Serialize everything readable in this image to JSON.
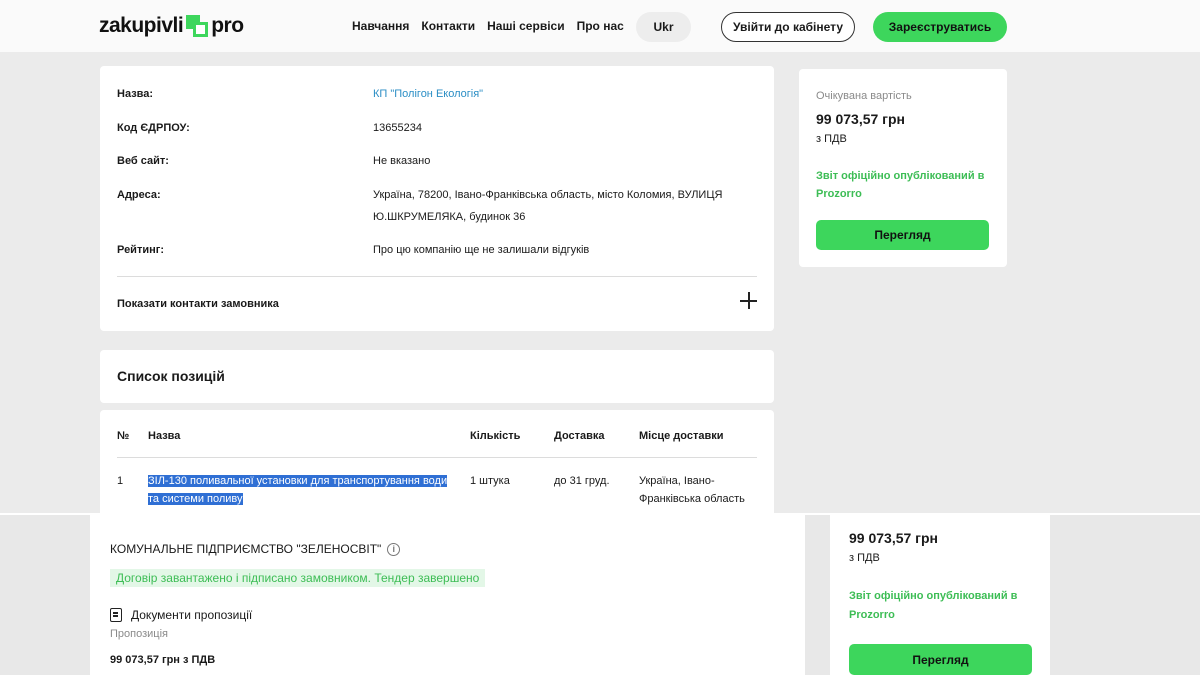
{
  "header": {
    "logo_left": "zakupivli",
    "logo_right": "pro",
    "nav": [
      "Навчання",
      "Контакти",
      "Наші сервіси",
      "Про нас"
    ],
    "lang": "Ukr",
    "login": "Увійти до кабінету",
    "register": "Зареєструватись"
  },
  "customer": {
    "rows": [
      {
        "label": "Назва:",
        "value": "КП \"Полігон Екологія\""
      },
      {
        "label": "Код ЄДРПОУ:",
        "value": "13655234"
      },
      {
        "label": "Веб сайт:",
        "value": "Не вказано"
      },
      {
        "label": "Адреса:",
        "value": "Україна, 78200, Івано-Франківська область, місто Коломия, ВУЛИЦЯ Ю.ШКРУМЕЛЯКА, будинок 36"
      },
      {
        "label": "Рейтинг:",
        "value": "Про цю компанію ще не залишали відгуків"
      }
    ],
    "show_contacts": "Показати контакти замовника"
  },
  "summary": {
    "expected_label": "Очікувана вартість",
    "price": "99 073,57 грн",
    "vat": "з ПДВ",
    "published": "Звіт офіційно опублікований в Prozorro",
    "view_button": "Перегляд"
  },
  "items": {
    "title": "Список позицій",
    "columns": [
      "№",
      "Назва",
      "Кількість",
      "Доставка",
      "Місце доставки"
    ],
    "rows": [
      {
        "num": "1",
        "name": "ЗІЛ-130 поливальної установки для транспортування води та системи поливу",
        "qty": "1 штука",
        "delivery": "до 31 груд.",
        "place": "Україна, Івано-Франківська область"
      }
    ]
  },
  "bid": {
    "company": "КОМУНАЛЬНЕ ПІДПРИЄМСТВО \"ЗЕЛЕНОСВІТ\"",
    "status": "Договір завантажено і підписано замовником. Тендер завершено",
    "documents": "Документи пропозиції",
    "proposal_label": "Пропозиція",
    "proposal_value": "99 073,57 грн з ПДВ"
  },
  "bottom_summary": {
    "price": "99 073,57 грн",
    "vat": "з ПДВ",
    "published": "Звіт офіційно опублікований в Prozorro",
    "view_button": "Перегляд"
  },
  "colors": {
    "accent": "#3dd65c",
    "link": "#2b8ec5",
    "selection": "#2f6fd4"
  }
}
